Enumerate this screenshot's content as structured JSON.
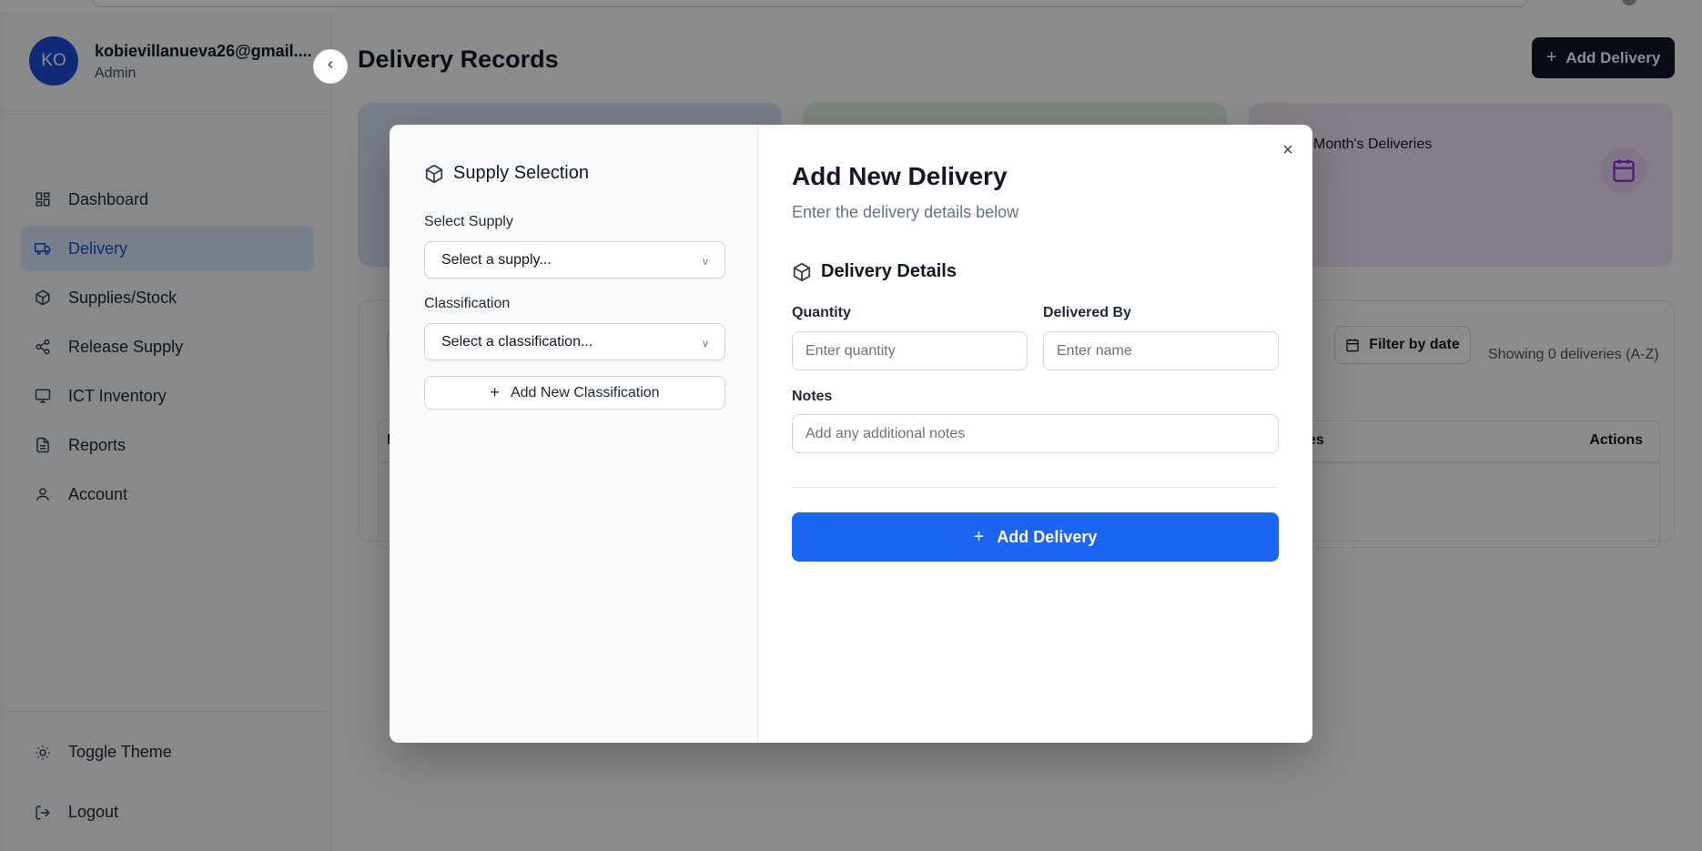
{
  "profile": {
    "initials": "KO",
    "email": "kobievillanueva26@gmail....",
    "role": "Admin"
  },
  "sidebar": {
    "items": [
      {
        "label": "Dashboard",
        "icon": "layout-dashboard-icon",
        "active": false
      },
      {
        "label": "Delivery",
        "icon": "truck-icon",
        "active": true
      },
      {
        "label": "Supplies/Stock",
        "icon": "package-icon",
        "active": false
      },
      {
        "label": "Release Supply",
        "icon": "share-icon",
        "active": false
      },
      {
        "label": "ICT Inventory",
        "icon": "monitor-icon",
        "active": false
      },
      {
        "label": "Reports",
        "icon": "file-text-icon",
        "active": false
      },
      {
        "label": "Account",
        "icon": "user-icon",
        "active": false
      }
    ],
    "bottom": {
      "toggle_theme": "Toggle Theme",
      "logout": "Logout"
    }
  },
  "main": {
    "title": "Delivery Records",
    "add_button": "Add Delivery",
    "stats": {
      "month_label": "Month's Deliveries"
    },
    "filter_button": "Filter by date",
    "showing": "Showing 0 deliveries (A-Z)",
    "table": {
      "col_id": "ID",
      "col_es": "es",
      "col_actions": "Actions"
    }
  },
  "modal": {
    "left": {
      "title": "Supply Selection",
      "supply_label": "Select Supply",
      "supply_value": "Select a supply...",
      "classification_label": "Classification",
      "classification_value": "Select a classification...",
      "chevron": "v",
      "add_classification": "Add New Classification"
    },
    "close": "×",
    "title": "Add New Delivery",
    "subtitle": "Enter the delivery details below",
    "section_title": "Delivery Details",
    "quantity_label": "Quantity",
    "quantity_placeholder": "Enter quantity",
    "delivered_by_label": "Delivered By",
    "delivered_by_placeholder": "Enter name",
    "notes_label": "Notes",
    "notes_placeholder": "Add any additional notes",
    "submit": "Add Delivery"
  },
  "colors": {
    "accent": "#1c64f2",
    "active_nav": "#1d4ed8",
    "dark_button": "#111827"
  }
}
